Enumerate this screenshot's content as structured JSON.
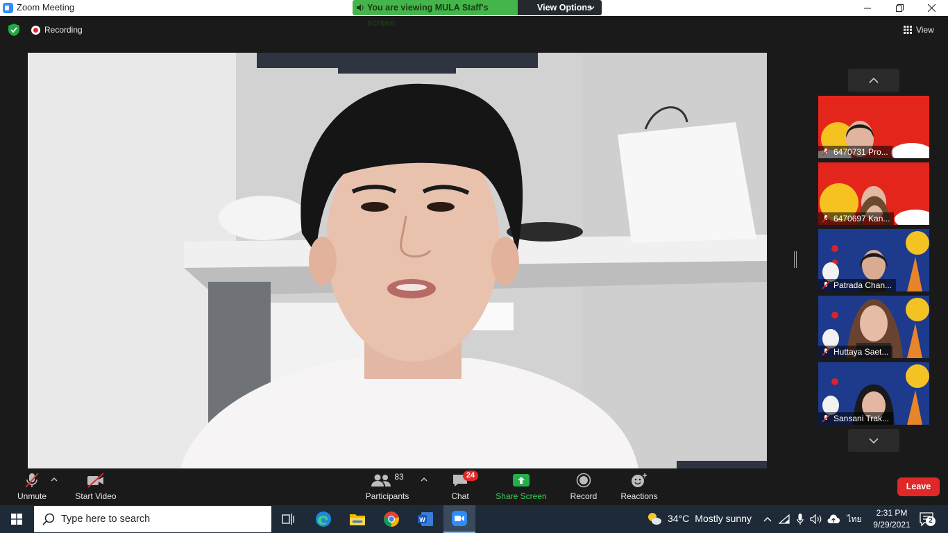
{
  "window": {
    "title": "Zoom Meeting",
    "share_banner": "You are viewing MULA Staff's screen",
    "view_options_label": "View Options"
  },
  "meeting": {
    "recording_label": "Recording",
    "view_label": "View"
  },
  "gallery": {
    "participants": [
      {
        "name": "6470731 Pro...",
        "background": "red-moon-festival"
      },
      {
        "name": "6470697 Kan...",
        "background": "red-moon-festival"
      },
      {
        "name": "Patrada Chan...",
        "background": "blue-lantern-rabbit"
      },
      {
        "name": "Huttaya Saet...",
        "background": "blue-lantern-rabbit"
      },
      {
        "name": "Sansani Trak...",
        "background": "blue-lantern-rabbit"
      }
    ]
  },
  "toolbar": {
    "unmute_label": "Unmute",
    "start_video_label": "Start Video",
    "participants_label": "Participants",
    "participants_count": "83",
    "chat_label": "Chat",
    "chat_badge": "24",
    "share_screen_label": "Share Screen",
    "record_label": "Record",
    "reactions_label": "Reactions",
    "leave_label": "Leave"
  },
  "taskbar": {
    "search_placeholder": "Type here to search",
    "weather_temp": "34°C",
    "weather_desc": "Mostly sunny",
    "language": "ไทย",
    "time": "2:31 PM",
    "date": "9/29/2021",
    "notification_count": "2"
  },
  "colors": {
    "share_green": "#44b54a",
    "leave_red": "#e02828",
    "toolbar_bg": "#1a1a1a",
    "taskbar_bg": "#1e2a38"
  }
}
